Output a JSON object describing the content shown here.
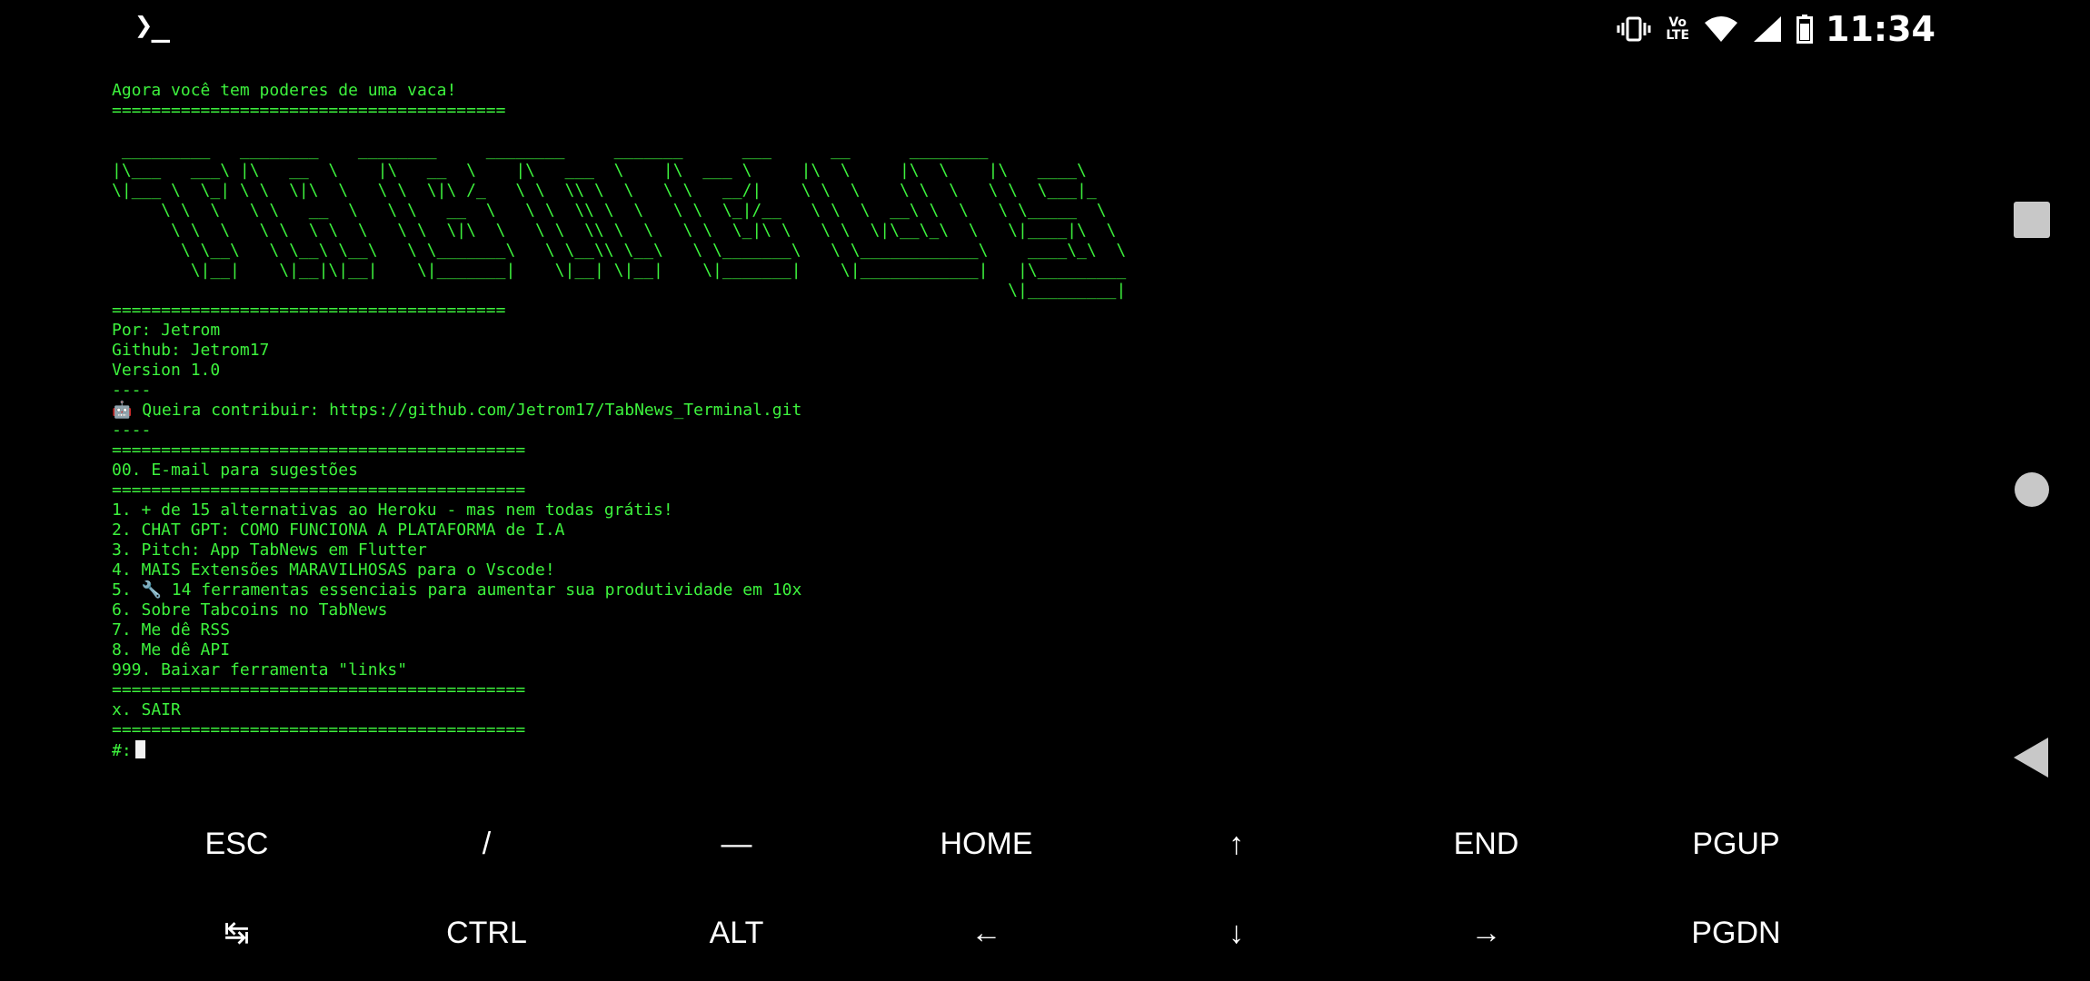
{
  "status_bar": {
    "app_glyph": "❯_",
    "volte_top": "Vo",
    "volte_bottom": "LTE",
    "time": "11:34"
  },
  "terminal": {
    "output": "Agora você tem poderes de uma vaca!\n========================================\n\n _________   ________    ________     ________     _______      ___      __      ________\n|\\___   ___\\ |\\   __  \\    |\\   __  \\    |\\   ___  \\    |\\  ___ \\     |\\  \\     |\\  \\    |\\   ____\\\n\\|___ \\  \\_| \\ \\  \\|\\  \\   \\ \\  \\|\\ /_   \\ \\  \\\\ \\  \\   \\ \\   __/|    \\ \\  \\    \\ \\  \\   \\ \\  \\___|_\n     \\ \\  \\   \\ \\   __  \\   \\ \\   __  \\   \\ \\  \\\\ \\  \\   \\ \\  \\_|/__   \\ \\  \\  __\\ \\  \\   \\ \\_____  \\\n      \\ \\  \\   \\ \\  \\ \\  \\   \\ \\  \\|\\  \\   \\ \\  \\\\ \\  \\   \\ \\  \\_|\\ \\   \\ \\  \\|\\__\\_\\  \\   \\|____|\\  \\\n       \\ \\__\\   \\ \\__\\ \\__\\   \\ \\_______\\   \\ \\__\\\\ \\__\\   \\ \\_______\\   \\ \\____________\\    ____\\_\\  \\\n        \\|__|    \\|__|\\|__|    \\|_______|    \\|__| \\|__|    \\|_______|    \\|____________|   |\\_________\n                                                                                           \\|_________|\n========================================\nPor: Jetrom\nGithub: Jetrom17\nVersion 1.0\n----\n🤖 Queira contribuir: https://github.com/Jetrom17/TabNews_Terminal.git\n----\n==========================================\n00. E-mail para sugestões\n==========================================\n1. + de 15 alternativas ao Heroku - mas nem todas grátis!\n2. CHAT GPT: COMO FUNCIONA A PLATAFORMA de I.A\n3. Pitch: App TabNews em Flutter\n4. MAIS Extensões MARAVILHOSAS para o Vscode!\n5. 🔧 14 ferramentas essenciais para aumentar sua produtividade em 10x\n6. Sobre Tabcoins no TabNews\n7. Me dê RSS\n8. Me dê API\n999. Baixar ferramenta \"links\"\n==========================================\nx. SAIR\n==========================================\n",
    "prompt": "#:"
  },
  "extra_keys": {
    "row1": [
      "ESC",
      "/",
      "—",
      "HOME",
      "↑",
      "END",
      "PGUP"
    ],
    "row2": [
      "↹",
      "CTRL",
      "ALT",
      "←",
      "↓",
      "→",
      "PGDN"
    ]
  },
  "icons": {
    "vibrate": "vibrate-icon",
    "wifi": "wifi-icon",
    "signal": "signal-icon",
    "battery": "battery-icon",
    "recent": "recent-apps-icon",
    "home": "home-icon",
    "back": "back-icon"
  },
  "colors": {
    "terminal_text": "#3df23d",
    "background": "#000000",
    "cursor": "#f2f2f2"
  }
}
